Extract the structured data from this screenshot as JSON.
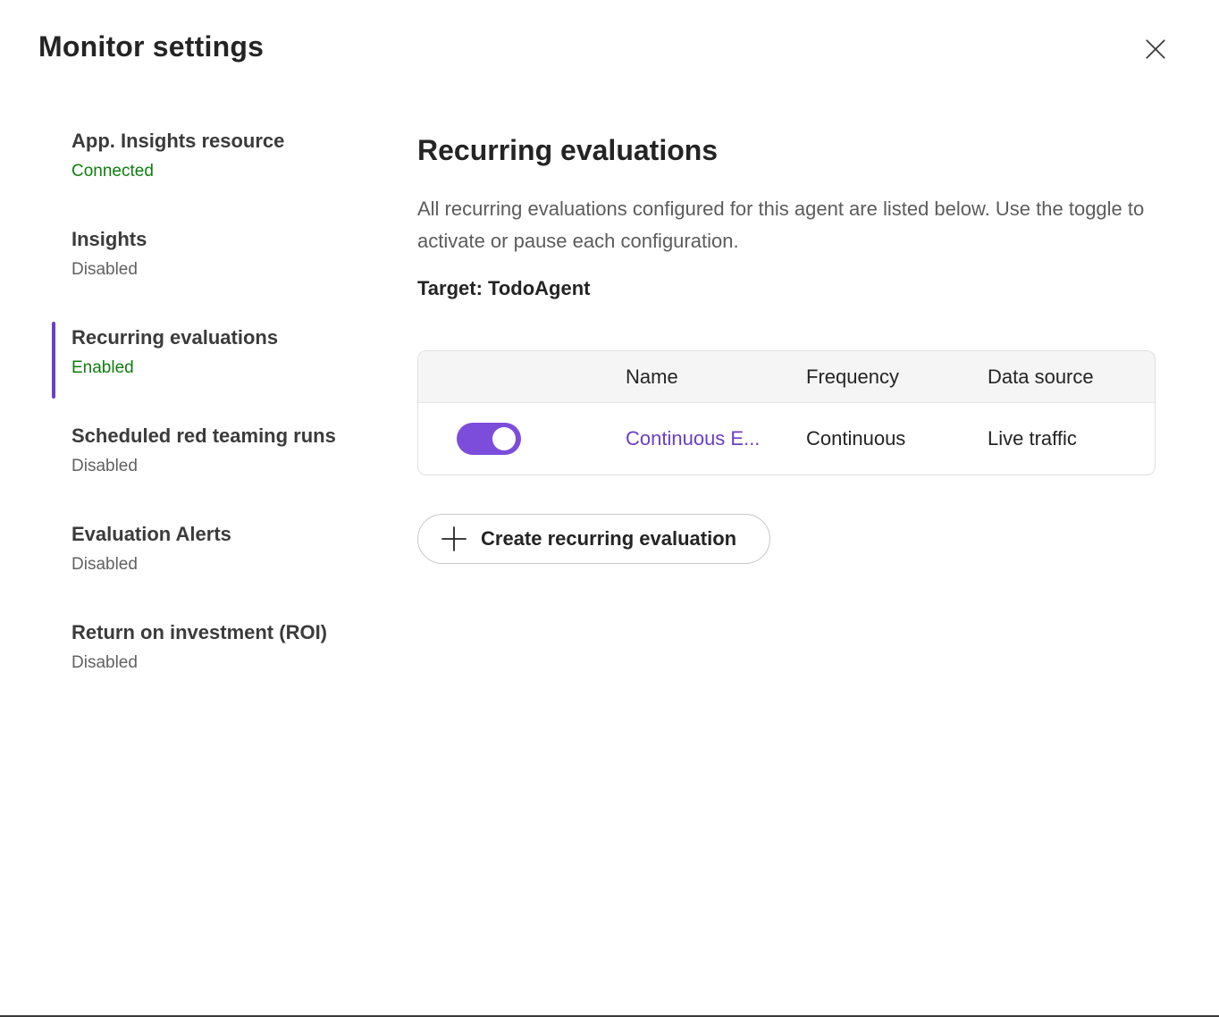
{
  "dialog": {
    "title": "Monitor settings",
    "close_icon": "close-icon"
  },
  "nav": {
    "items": [
      {
        "label": "App. Insights resource",
        "status": "Connected"
      },
      {
        "label": "Insights",
        "status": "Disabled"
      },
      {
        "label": "Recurring evaluations",
        "status": "Enabled"
      },
      {
        "label": "Scheduled red teaming runs",
        "status": "Disabled"
      },
      {
        "label": "Evaluation Alerts",
        "status": "Disabled"
      },
      {
        "label": "Return on investment (ROI)",
        "status": "Disabled"
      }
    ],
    "active_index": 2
  },
  "main": {
    "title": "Recurring evaluations",
    "description": "All recurring evaluations configured for this agent are listed below. Use the toggle to activate or pause each configuration.",
    "target": "Target: TodoAgent",
    "table": {
      "headers": [
        "Name",
        "Frequency",
        "Data source"
      ],
      "rows": [
        {
          "enabled": true,
          "name": "Continuous E...",
          "frequency": "Continuous",
          "data_source": "Live traffic"
        }
      ]
    },
    "create_button": "Create recurring evaluation",
    "create_icon": "plus-icon"
  },
  "colors": {
    "accent": "#6b3fc4",
    "toggle_on": "#7c4ddb",
    "status_green": "#107c10",
    "status_gray": "#616161"
  }
}
